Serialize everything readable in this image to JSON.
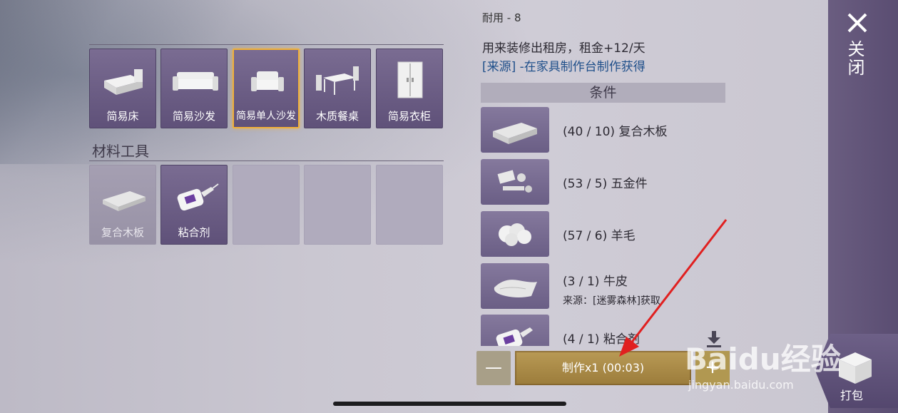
{
  "categories": {
    "furniture": [
      {
        "label": "简易床",
        "icon": "bed-icon",
        "selected": false
      },
      {
        "label": "简易沙发",
        "icon": "sofa-icon",
        "selected": false
      },
      {
        "label": "简易单人沙发",
        "icon": "armchair-icon",
        "selected": true
      },
      {
        "label": "木质餐桌",
        "icon": "dining-table-icon",
        "selected": false
      },
      {
        "label": "简易衣柜",
        "icon": "wardrobe-icon",
        "selected": false
      }
    ],
    "materials_title": "材料工具",
    "materials": [
      {
        "label": "复合木板",
        "icon": "plank-icon",
        "disabled": true
      },
      {
        "label": "粘合剂",
        "icon": "glue-icon",
        "disabled": false
      }
    ]
  },
  "detail": {
    "truncated_top": "耐用 - 8",
    "description": "用来装修出租房，租金+12/天",
    "source": "[来源] -在家具制作台制作获得",
    "conditions_title": "条件",
    "requirements": [
      {
        "text": "(40 / 10) 复合木板",
        "icon": "plank-icon"
      },
      {
        "text": "(53 / 5) 五金件",
        "icon": "hardware-icon"
      },
      {
        "text": "(57 / 6) 羊毛",
        "icon": "wool-icon"
      },
      {
        "text": "(3 / 1) 牛皮",
        "sub": "来源：[迷雾森林]获取",
        "icon": "leather-icon"
      },
      {
        "text": "(4 / 1) 粘合剂",
        "icon": "glue-icon"
      }
    ]
  },
  "controls": {
    "minus": "—",
    "craft_label": "制作x1 (00:03)",
    "plus": "+"
  },
  "side": {
    "close_label": "关闭",
    "pack_label": "打包"
  },
  "watermark": {
    "text": "Baidu经验",
    "sub": "jingyan.baidu.com"
  },
  "colors": {
    "accent": "#f0b03a",
    "source_blue": "#1f4f8a",
    "tile": "#6f628a"
  }
}
